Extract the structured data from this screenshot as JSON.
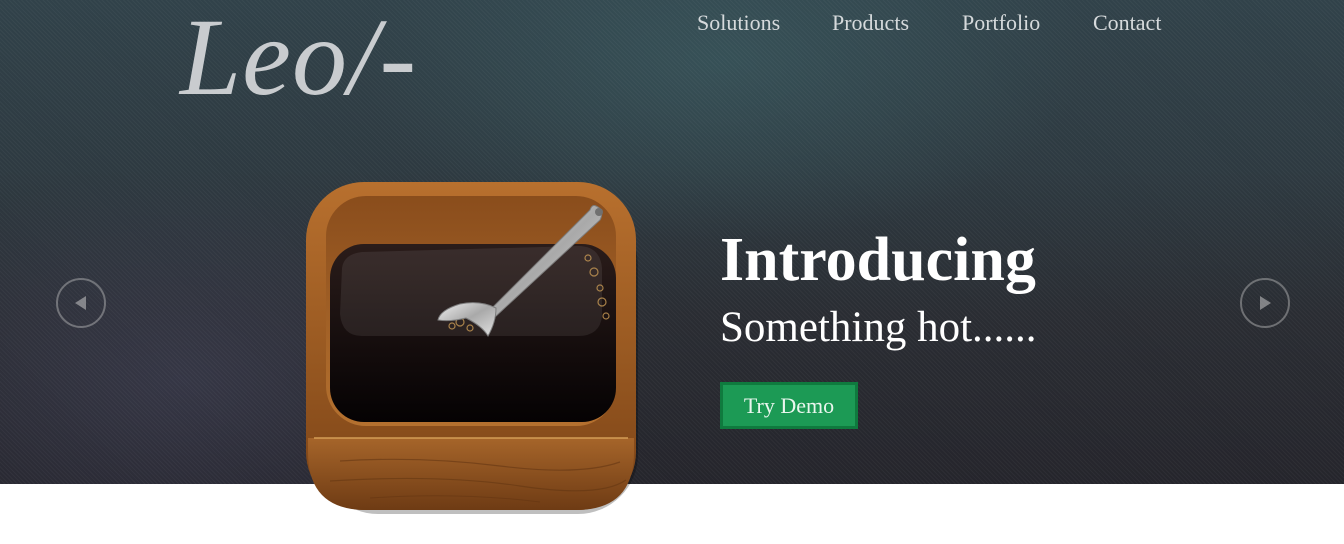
{
  "logo": {
    "text": "Leo/-"
  },
  "nav": {
    "items": [
      {
        "label": "Solutions"
      },
      {
        "label": "Products"
      },
      {
        "label": "Portfolio"
      },
      {
        "label": "Contact"
      }
    ]
  },
  "hero": {
    "headline": "Introducing",
    "subline": "Something hot......",
    "cta_label": "Try Demo",
    "prev_icon": "triangle-left-icon",
    "next_icon": "triangle-right-icon",
    "image_subject": "coffee-app-icon"
  },
  "colors": {
    "cta_background": "#1c9a55",
    "cta_border": "#0f7a3e",
    "nav_text": "#d6dadc",
    "logo_text": "#c9cccf"
  }
}
